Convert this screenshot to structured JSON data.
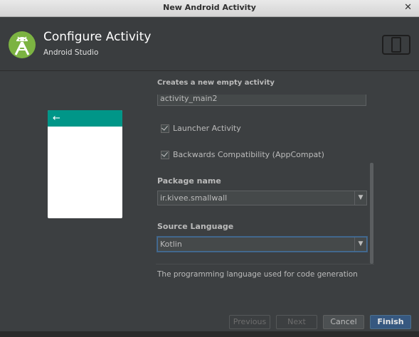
{
  "window": {
    "title": "New Android Activity"
  },
  "header": {
    "title": "Configure Activity",
    "subtitle": "Android Studio"
  },
  "preview": {
    "back_glyph": "←",
    "app_bar_color": "#009688"
  },
  "form": {
    "caption": "Creates a new empty activity",
    "layout_name_value": "activity_main2",
    "launcher_activity": {
      "label": "Launcher Activity",
      "checked": true
    },
    "backwards_compat": {
      "label": "Backwards Compatibility (AppCompat)",
      "checked": true
    },
    "package_name": {
      "label": "Package name",
      "value": "ir.kivee.smallwall"
    },
    "source_language": {
      "label": "Source Language",
      "value": "Kotlin"
    },
    "description": "The programming language used for code generation"
  },
  "buttons": {
    "previous": "Previous",
    "next": "Next",
    "cancel": "Cancel",
    "finish": "Finish"
  },
  "colors": {
    "primary_button": "#365880",
    "android_green": "#a4c639"
  }
}
